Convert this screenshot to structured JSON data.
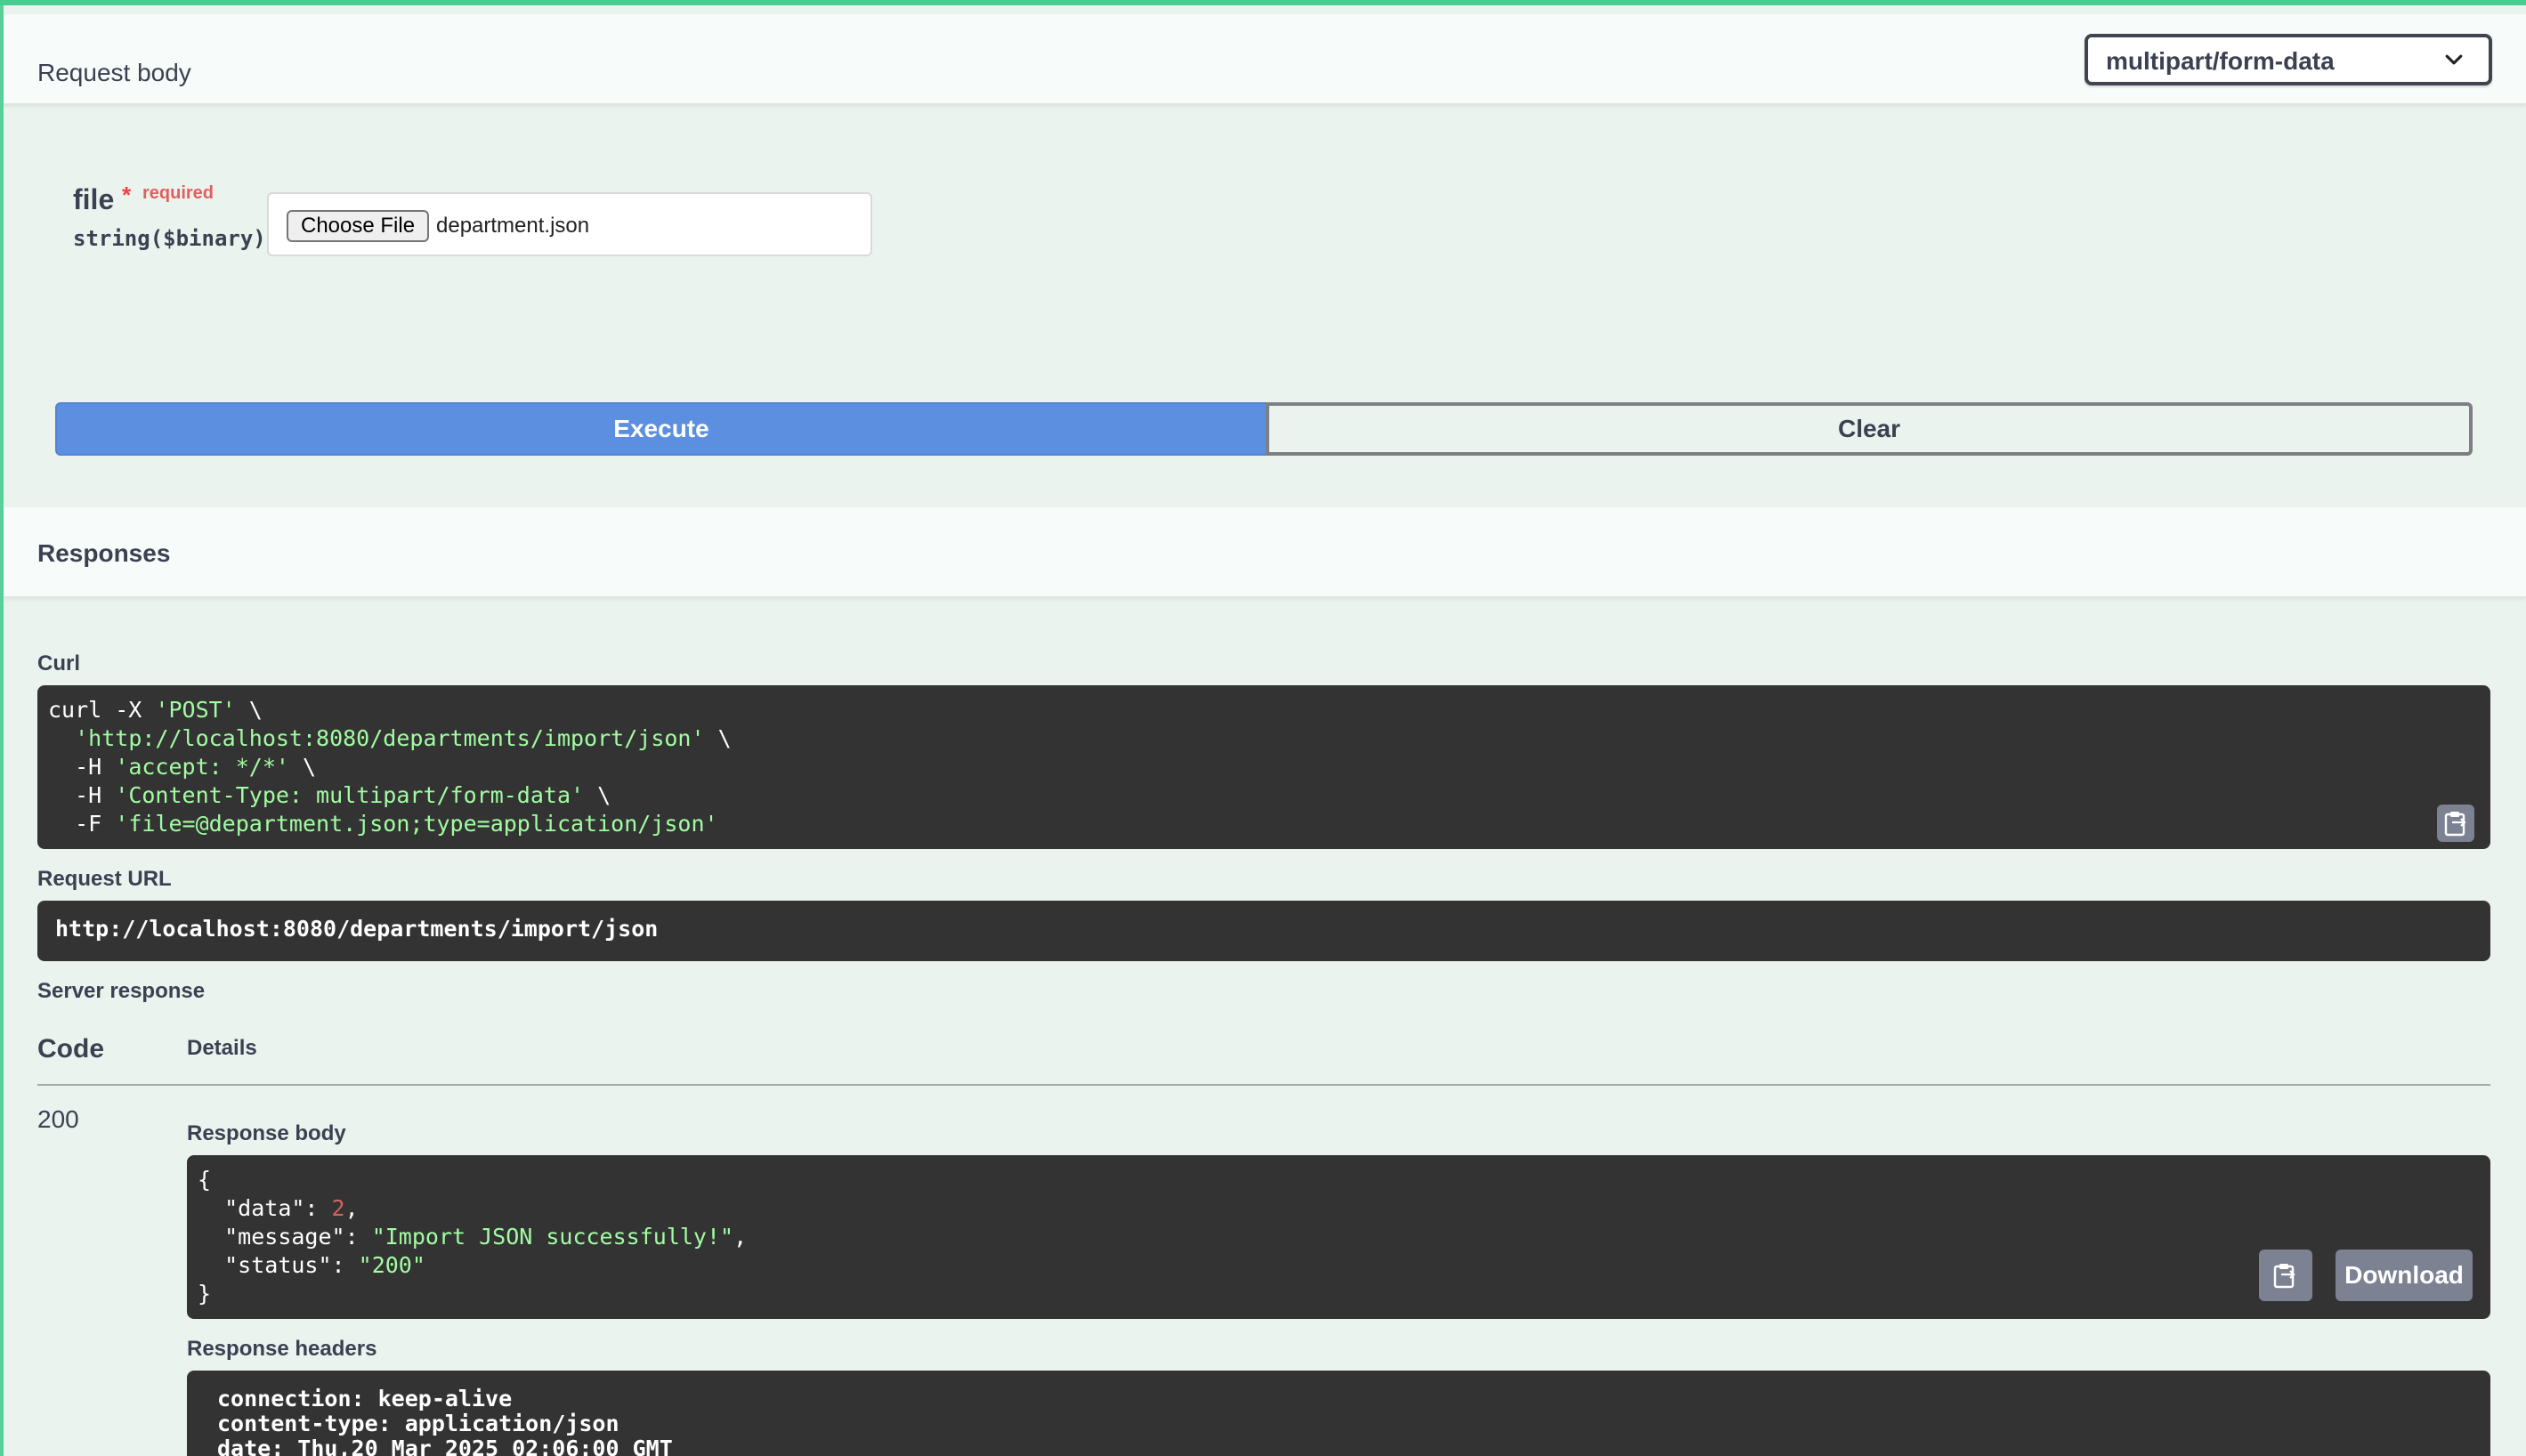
{
  "request_body": {
    "title": "Request body",
    "content_type": "multipart/form-data"
  },
  "param": {
    "name": "file",
    "required_star": "*",
    "required_label": "required",
    "type": "string($binary)",
    "choose_button": "Choose File",
    "file_name": "department.json"
  },
  "actions": {
    "execute": "Execute",
    "clear": "Clear"
  },
  "responses": {
    "title": "Responses",
    "curl_label": "Curl",
    "curl_lines": [
      "curl -X ",
      "'POST'",
      " \\",
      "'http://localhost:8080/departments/import/json'",
      "-H ",
      "'accept: */*'",
      "'Content-Type: multipart/form-data'",
      "-F ",
      "'file=@department.json;type=application/json'"
    ],
    "request_url_label": "Request URL",
    "request_url": "http://localhost:8080/departments/import/json",
    "server_response_label": "Server response",
    "code_header": "Code",
    "details_header": "Details",
    "code": "200",
    "response_body_label": "Response body",
    "body": {
      "data_key": "\"data\"",
      "data_val": "2",
      "message_key": "\"message\"",
      "message_val": "\"Import JSON successfully!\"",
      "status_key": "\"status\"",
      "status_val": "\"200\""
    },
    "download": "Download",
    "response_headers_label": "Response headers",
    "headers": [
      "connection: keep-alive",
      "content-type: application/json",
      "date: Thu,20 Mar 2025 02:06:00 GMT"
    ]
  }
}
